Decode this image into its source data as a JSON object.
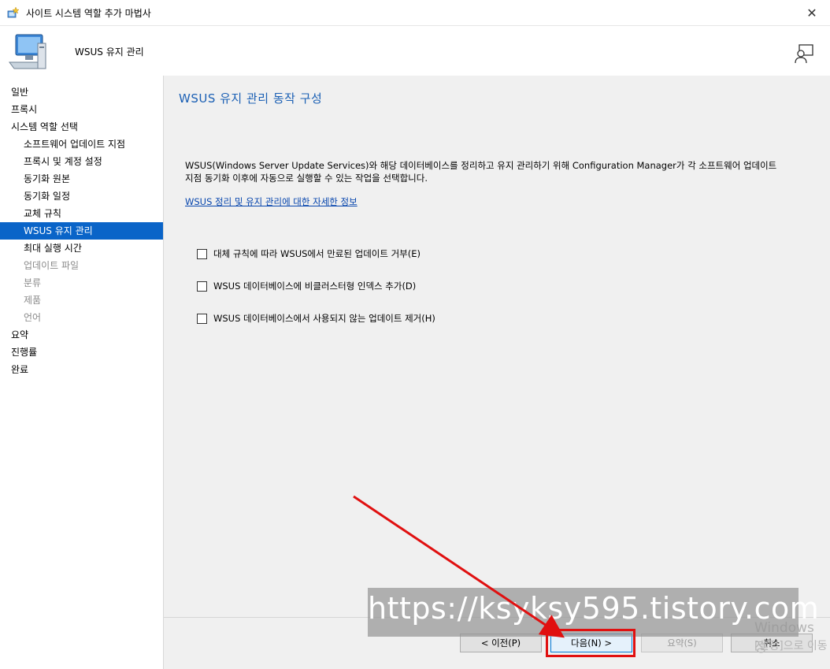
{
  "window": {
    "title": "사이트 시스템 역할 추가 마법사",
    "close_symbol": "✕",
    "icon": "wizard-icon"
  },
  "header": {
    "title": "WSUS 유지 관리",
    "icon": "computer-icon",
    "help_icon": "help-person-icon"
  },
  "nav": {
    "items": [
      {
        "label": "일반",
        "level": 0,
        "state": "normal"
      },
      {
        "label": "프록시",
        "level": 0,
        "state": "normal"
      },
      {
        "label": "시스템 역할 선택",
        "level": 0,
        "state": "normal"
      },
      {
        "label": "소프트웨어 업데이트 지점",
        "level": 1,
        "state": "normal"
      },
      {
        "label": "프록시 및 계정 설정",
        "level": 1,
        "state": "normal"
      },
      {
        "label": "동기화 원본",
        "level": 1,
        "state": "normal"
      },
      {
        "label": "동기화 일정",
        "level": 1,
        "state": "normal"
      },
      {
        "label": "교체 규칙",
        "level": 1,
        "state": "normal"
      },
      {
        "label": "WSUS 유지 관리",
        "level": 1,
        "state": "active"
      },
      {
        "label": "최대 실행 시간",
        "level": 1,
        "state": "normal"
      },
      {
        "label": "업데이트 파일",
        "level": 1,
        "state": "disabled"
      },
      {
        "label": "분류",
        "level": 1,
        "state": "disabled"
      },
      {
        "label": "제품",
        "level": 1,
        "state": "disabled"
      },
      {
        "label": "언어",
        "level": 1,
        "state": "disabled"
      },
      {
        "label": "요약",
        "level": 0,
        "state": "normal"
      },
      {
        "label": "진행률",
        "level": 0,
        "state": "normal"
      },
      {
        "label": "완료",
        "level": 0,
        "state": "normal"
      }
    ]
  },
  "main": {
    "page_title": "WSUS 유지 관리 동작 구성",
    "description_line1": "WSUS(Windows Server Update Services)와 해당 데이터베이스를 정리하고 유지 관리하기 위해 Configuration Manager가 각 소프트웨어 업데이트",
    "description_line2": "지점 동기화 이후에 자동으로 실행할 수 있는 작업을 선택합니다.",
    "link": "WSUS 정리 및 유지 관리에 대한 자세한 정보",
    "options": [
      {
        "label": "대체 규칙에 따라 WSUS에서 만료된 업데이트 거부(E)",
        "checked": false
      },
      {
        "label": "WSUS 데이터베이스에 비클러스터형 인덱스 추가(D)",
        "checked": false
      },
      {
        "label": "WSUS 데이터베이스에서 사용되지 않는 업데이트 제거(H)",
        "checked": false
      }
    ]
  },
  "buttons": {
    "prev": "< 이전(P)",
    "next": "다음(N) >",
    "summary": "요약(S)",
    "cancel": "취소"
  },
  "watermark": "https://ksyksy595.tistory.com",
  "windows_activation": {
    "line1": "Windows 정",
    "line2": "[설정]으로 이동"
  },
  "colors": {
    "accent": "#0a64c8",
    "title_blue": "#1a5fb4",
    "highlight_red": "#e01010"
  }
}
